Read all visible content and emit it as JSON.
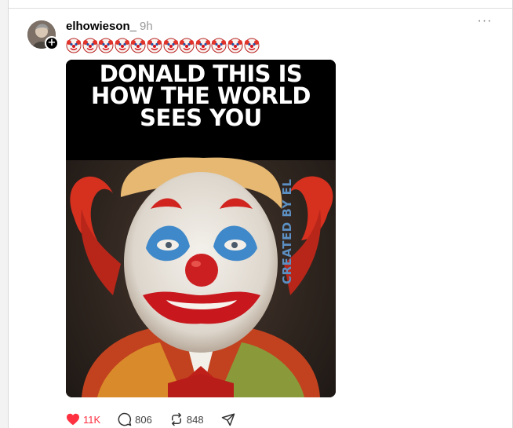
{
  "post": {
    "username": "elhowieson_",
    "timestamp": "9h",
    "follow_symbol": "+",
    "more_label": "···",
    "caption_emojis": [
      "clown-face",
      "clown-face",
      "clown-face",
      "clown-face",
      "clown-face",
      "clown-face",
      "clown-face",
      "clown-face",
      "clown-face",
      "clown-face",
      "clown-face",
      "clown-face"
    ],
    "image": {
      "headline": "DONALD THIS IS HOW THE WORLD SEES YOU",
      "watermark": "CREATED BY EL"
    },
    "actions": {
      "likes": "11K",
      "comments": "806",
      "reposts": "848",
      "liked": true
    }
  },
  "colors": {
    "like_red": "#ff3040",
    "muted_text": "#999999",
    "card_bg": "#ffffff",
    "page_bg": "#f3f3f3"
  },
  "icons": [
    "clown-face-icon",
    "heart-icon",
    "comment-icon",
    "repost-icon",
    "share-icon",
    "more-icon",
    "plus-icon"
  ]
}
